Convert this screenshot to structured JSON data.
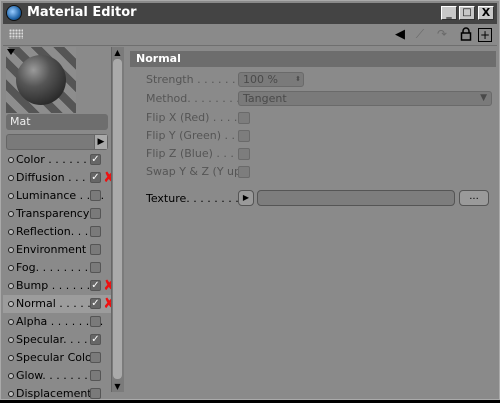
{
  "window": {
    "title": "Material Editor",
    "controls": {
      "minimize": "_",
      "maximize": "□",
      "close": "X"
    }
  },
  "toolbar": {
    "icons": [
      "grip-icon",
      "back-arrow-icon",
      "forward-arrow-icon",
      "refresh-icon",
      "lock-icon",
      "new-window-icon"
    ],
    "new_label": "+"
  },
  "material": {
    "name": "Mat"
  },
  "channels": [
    {
      "label": "Color",
      "dots": " . . . . . . . .",
      "checked": true,
      "marked": false
    },
    {
      "label": "Diffusion",
      "dots": " . . . . .",
      "checked": true,
      "marked": true
    },
    {
      "label": "Luminance",
      "dots": " . . . .",
      "checked": false,
      "marked": false
    },
    {
      "label": "Transparency",
      "dots": "",
      "checked": false,
      "marked": false
    },
    {
      "label": "Reflection",
      "dots": ". . . .",
      "checked": false,
      "marked": false
    },
    {
      "label": "Environment",
      "dots": "",
      "checked": false,
      "marked": false
    },
    {
      "label": "Fog",
      "dots": ". . . . . . . . .",
      "checked": false,
      "marked": false
    },
    {
      "label": "Bump",
      "dots": " . . . . . . .",
      "checked": true,
      "marked": true
    },
    {
      "label": "Normal",
      "dots": " . . . . .",
      "checked": true,
      "marked": true,
      "selected": true
    },
    {
      "label": "Alpha",
      "dots": " . . . . . . . .",
      "checked": false,
      "marked": false
    },
    {
      "label": "Specular",
      "dots": ". . . . .",
      "checked": true,
      "marked": false
    },
    {
      "label": "Specular Color",
      "dots": "",
      "checked": false,
      "marked": false
    },
    {
      "label": "Glow",
      "dots": ". . . . . . . . .",
      "checked": false,
      "marked": false
    },
    {
      "label": "Displacement",
      "dots": "",
      "checked": false,
      "marked": false
    }
  ],
  "panel": {
    "title": "Normal",
    "strength_label": "Strength . . . . . . . . .",
    "strength_value": "100 %",
    "method_label": "Method. . . . . . . . .",
    "method_value": "Tangent",
    "flipx_label": "Flip X (Red) . . . . .",
    "flipy_label": "Flip Y (Green) . . . .",
    "flipz_label": "Flip Z (Blue) . . . . .",
    "swap_label": "Swap Y & Z (Y up)",
    "texture_label": "Texture. . . . . . . . . .",
    "texture_dots": "..."
  },
  "colors": {
    "window_bg": "#8a8a8a",
    "titlebar_bg": "#444444",
    "red_mark": "#e01111"
  }
}
